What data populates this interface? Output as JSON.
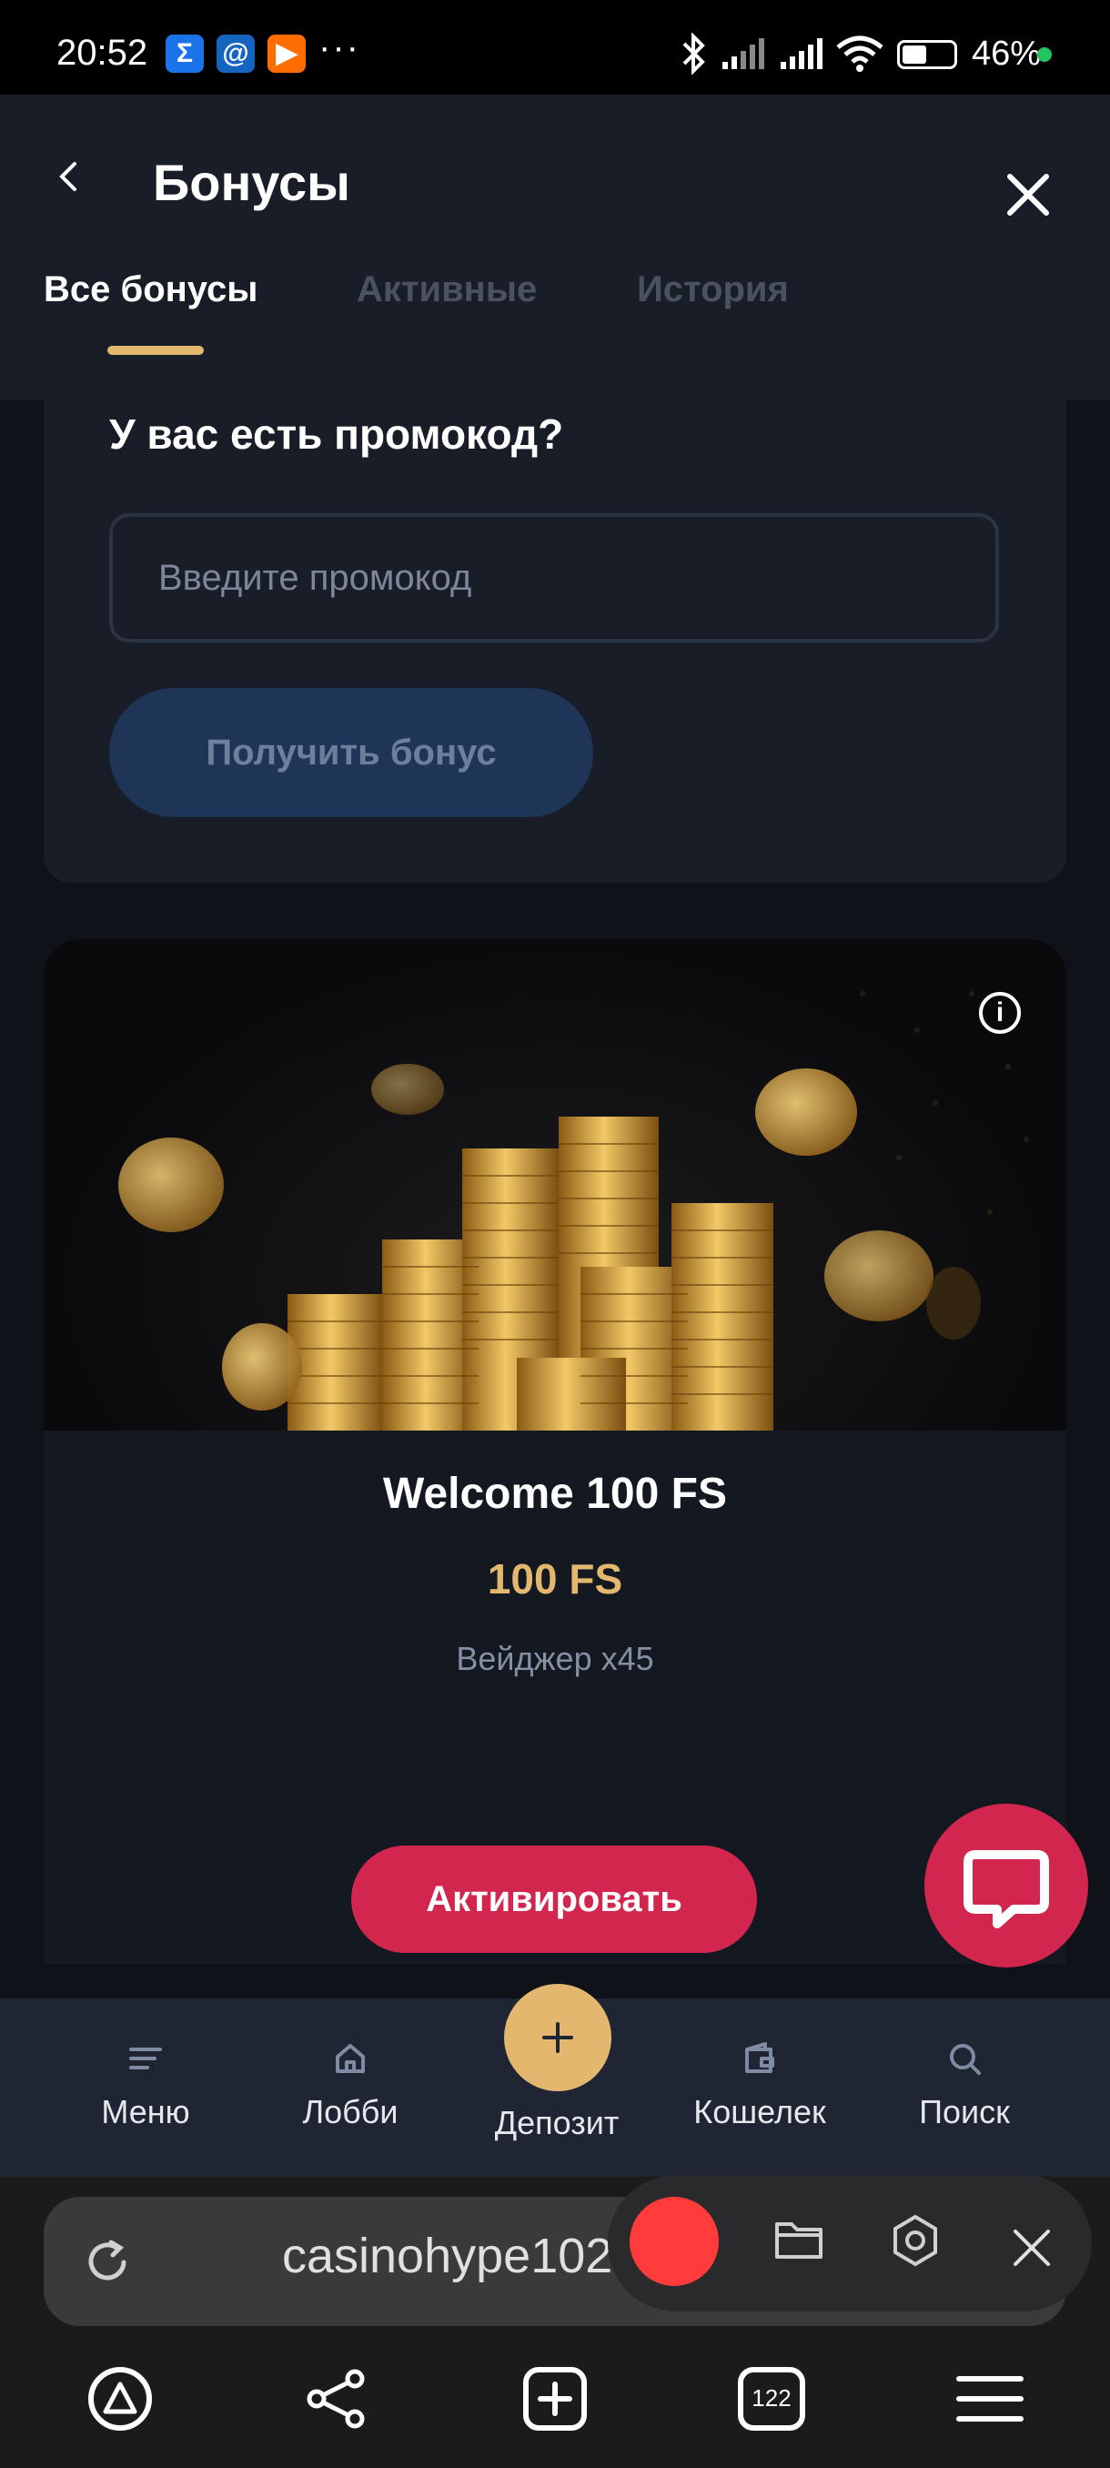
{
  "status_bar": {
    "time": "20:52",
    "dots": "···",
    "battery": "46%",
    "battery_level": 0.46
  },
  "header": {
    "title": "Бонусы"
  },
  "tabs": [
    {
      "label": "Все бонусы",
      "active": true
    },
    {
      "label": "Активные",
      "active": false
    },
    {
      "label": "История",
      "active": false
    }
  ],
  "promo": {
    "question": "У вас есть промокод?",
    "placeholder": "Введите промокод",
    "button_label": "Получить бонус"
  },
  "bonus": {
    "name": "Welcome 100 FS",
    "value": "100 FS",
    "wager": "Вейджер x45",
    "activate_label": "Активировать",
    "info": "i"
  },
  "bottom_nav": {
    "menu": "Меню",
    "lobby": "Лобби",
    "deposit": "Депозит",
    "wallet": "Кошелек",
    "search": "Поиск"
  },
  "browser": {
    "url": "casinohype102.com",
    "tabs_count": "122"
  },
  "colors": {
    "accent_gold": "#e3b76e",
    "accent_red": "#d3264f",
    "bg": "#0f1218",
    "panel": "#181d27"
  }
}
